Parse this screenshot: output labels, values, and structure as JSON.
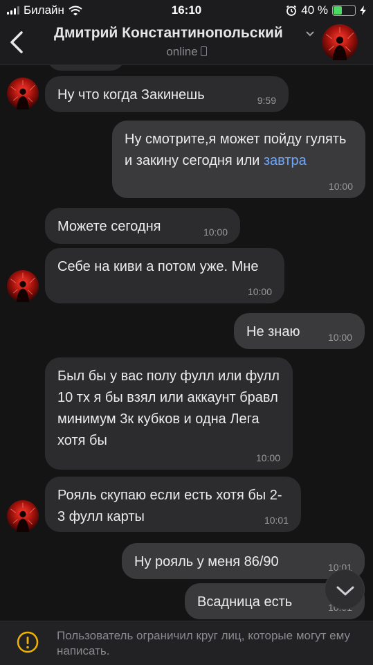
{
  "status_bar": {
    "carrier": "Билайн",
    "time": "16:10",
    "battery": "40 %",
    "battery_level": 0.4
  },
  "header": {
    "contact_name": "Дмитрий Константинопольский",
    "status": "online"
  },
  "messages": [
    {
      "direction": "in",
      "text": "Ну что когда Закинешь",
      "time": "9:59"
    },
    {
      "direction": "out",
      "text": "Ну смотрите,я может пойду гулять и закину сегодня или",
      "link": "завтра",
      "time": "10:00"
    },
    {
      "direction": "in",
      "text": "Можете сегодня",
      "time": "10:00"
    },
    {
      "direction": "in",
      "text": "Себе на киви а потом уже. Мне",
      "time": "10:00"
    },
    {
      "direction": "out",
      "text": "Не знаю",
      "time": "10:00"
    },
    {
      "direction": "in",
      "text": "Был бы у вас полу фулл или фулл 10 тх я бы взял или аккаунт бравл минимум 3к кубков и одна Лега хотя бы",
      "time": "10:00"
    },
    {
      "direction": "in",
      "text": "Рояль скупаю если есть хотя бы 2-3 фулл карты",
      "time": "10:01"
    },
    {
      "direction": "out",
      "text": "Ну рояль у меня 86/90",
      "time": "10:01"
    },
    {
      "direction": "out",
      "text": "Всадница есть",
      "time": "10:01"
    }
  ],
  "notice": {
    "text": "Пользователь ограничил круг лиц, которые могут ему написать."
  },
  "icons": {
    "back": "chevron-left-icon",
    "title_chevron": "chevron-down-icon",
    "scroll": "chevron-down-icon",
    "warning": "exclamation-circle-icon"
  },
  "colors": {
    "background": "#141414",
    "bubble_in": "#2c2c2e",
    "bubble_out": "#3a3a3c",
    "link": "#6fa8ff",
    "warning": "#f0b400",
    "battery": "#4cd964"
  }
}
